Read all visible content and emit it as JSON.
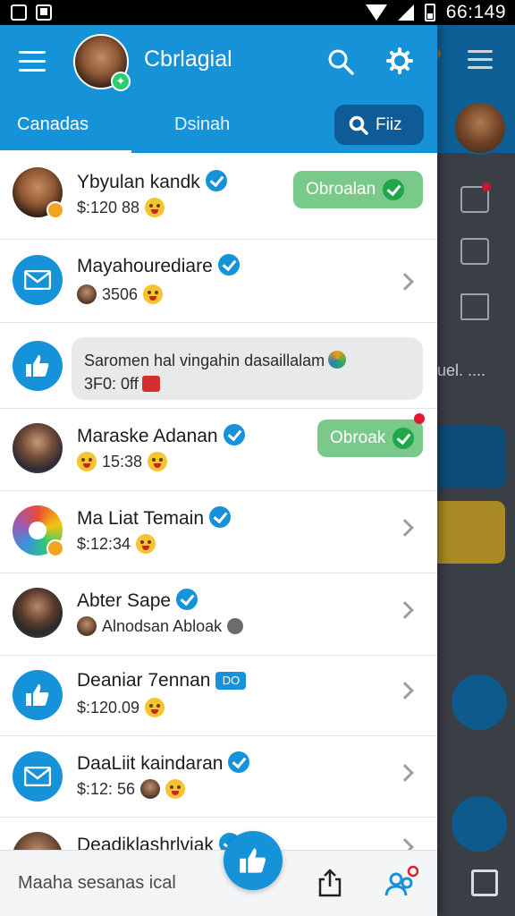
{
  "status_bar": {
    "time": "66:149"
  },
  "header": {
    "title": "Cbrlagial",
    "tabs": [
      {
        "label": "Canadas"
      },
      {
        "label": "Dsinah"
      }
    ],
    "filter_label": "Fiiz"
  },
  "rows": [
    {
      "name": "Ybyulan kandk",
      "sub": "$:120 88",
      "pill": "Obroalan"
    },
    {
      "name": "Mayahourediare",
      "sub": "3506"
    },
    {
      "bubble_line1": "Saromen hal vingahin dasaillalam",
      "bubble_line2": "3F0: 0ff"
    },
    {
      "name": "Maraske Adanan",
      "sub": "15:38",
      "pill": "Obroak"
    },
    {
      "name": "Ma Liat Temain",
      "sub": "$:12:34"
    },
    {
      "name": "Abter Sape",
      "sub": "Alnodsan Abloak"
    },
    {
      "name": "Deaniar 7ennan",
      "badge": "DO",
      "sub": "$:120.09"
    },
    {
      "name": "DaaLiit kaindaran",
      "sub": "$:12: 56"
    },
    {
      "name": "Deadiklashrlviak"
    }
  ],
  "bottom_bar": {
    "text": "Maaha sesanas ical"
  },
  "background_app": {
    "snippet": "uel. ...."
  },
  "colors": {
    "primary": "#1592d8",
    "header_dark": "#0e5b96",
    "pill_green": "#79c98a",
    "check_green": "#1ea84a"
  }
}
